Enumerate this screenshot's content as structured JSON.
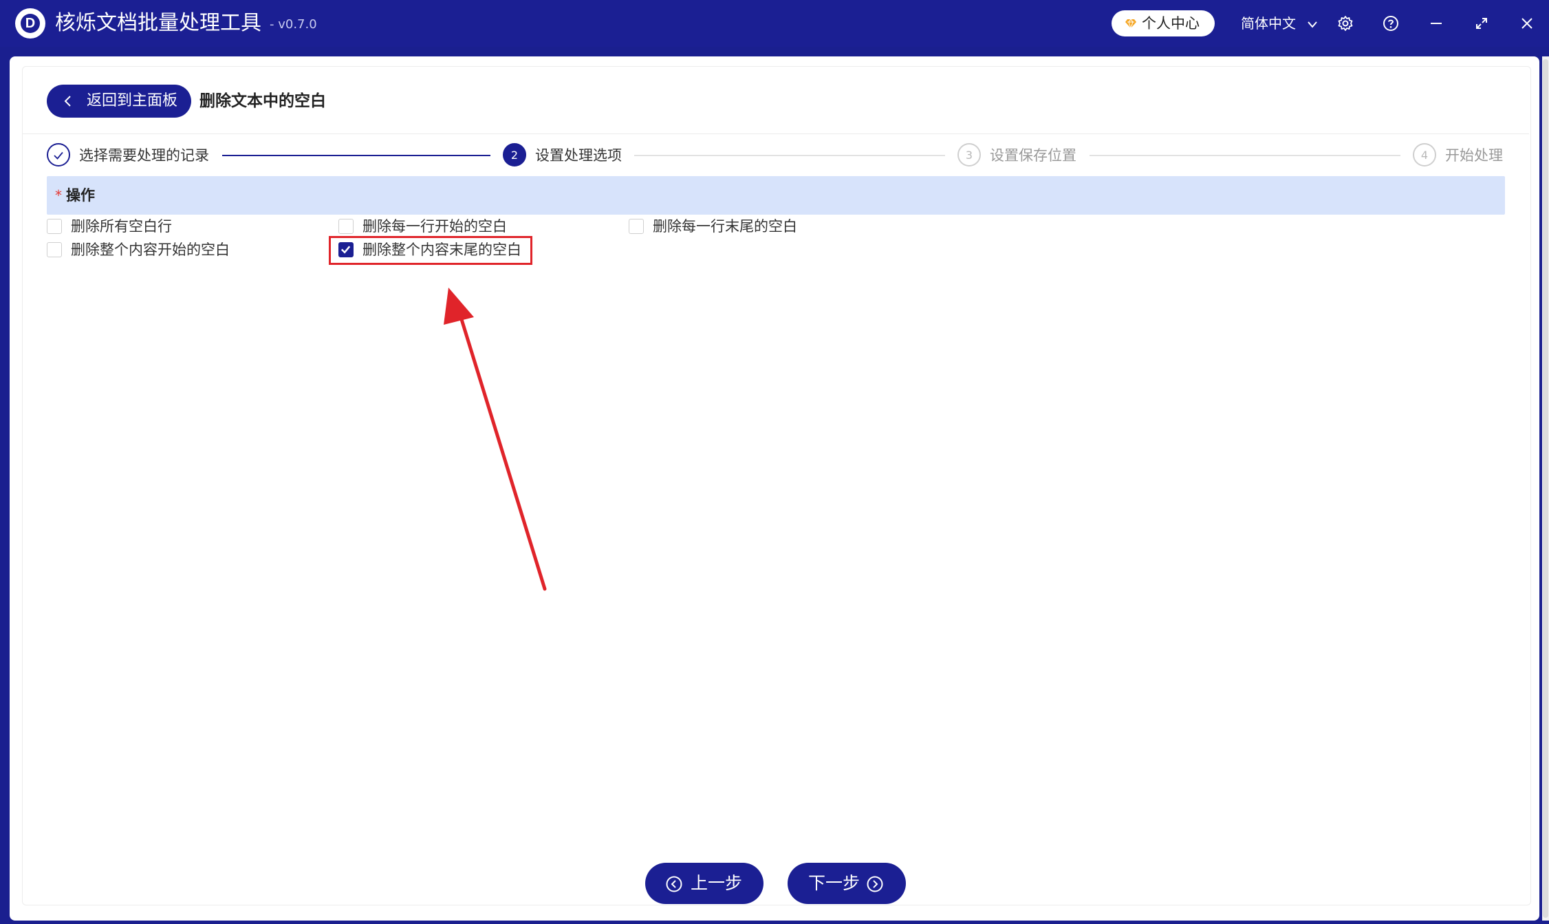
{
  "app": {
    "logo_letter": "D",
    "title": "核烁文档批量处理工具",
    "version": "- v0.7.0",
    "user_center_label": "个人中心",
    "language": "简体中文"
  },
  "icons": {
    "user_center": "diamond-icon",
    "language": "chevron-down-icon",
    "settings": "gear-icon",
    "help": "help-icon",
    "minimize": "minimize-icon",
    "maximize": "maximize-icon",
    "close": "close-icon"
  },
  "header": {
    "back_label": "返回到主面板",
    "page_title": "删除文本中的空白"
  },
  "steps": [
    {
      "number": "1",
      "label": "选择需要处理的记录",
      "state": "done"
    },
    {
      "number": "2",
      "label": "设置处理选项",
      "state": "active"
    },
    {
      "number": "3",
      "label": "设置保存位置",
      "state": "todo"
    },
    {
      "number": "4",
      "label": "开始处理",
      "state": "todo"
    }
  ],
  "section": {
    "required_mark": "*",
    "title": "操作"
  },
  "options": [
    {
      "label": "删除所有空白行",
      "checked": false
    },
    {
      "label": "删除每一行开始的空白",
      "checked": false
    },
    {
      "label": "删除每一行末尾的空白",
      "checked": false
    },
    {
      "label": "删除整个内容开始的空白",
      "checked": false
    },
    {
      "label": "删除整个内容末尾的空白",
      "checked": true
    }
  ],
  "footer": {
    "prev_label": "上一步",
    "next_label": "下一步"
  },
  "colors": {
    "primary": "#1b1f93",
    "section_header_bg": "#d7e3fb",
    "annotation_red": "#e0242a",
    "required_red": "#e53935"
  }
}
